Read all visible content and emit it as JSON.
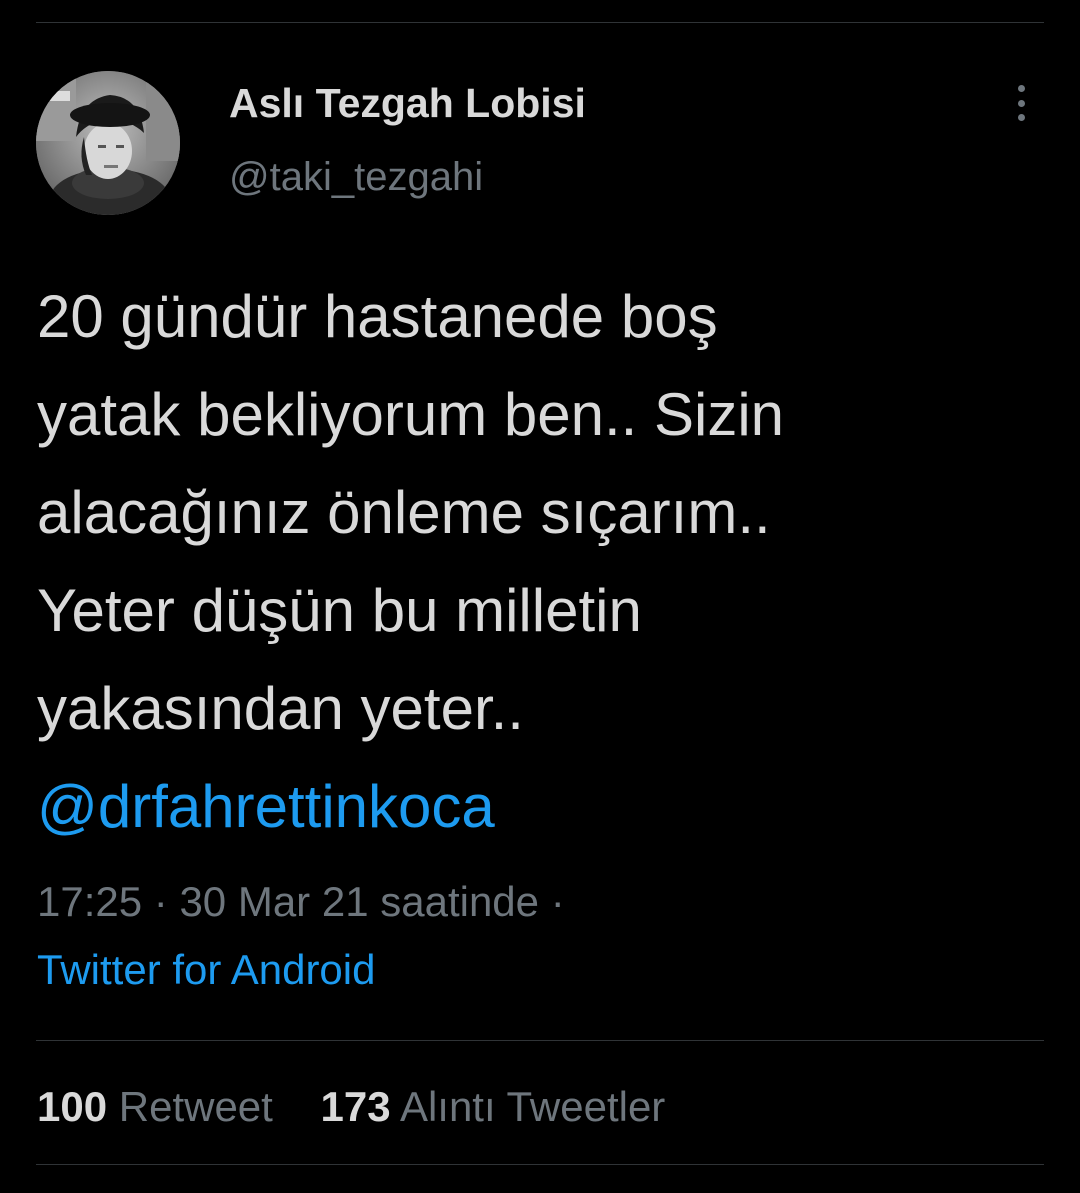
{
  "author": {
    "name": "Aslı Tezgah Lobisi",
    "handle": "@taki_tezgahi",
    "avatar_icon": "profile-photo"
  },
  "more_icon": "vertical-ellipsis-icon",
  "tweet": {
    "lines": [
      "20 gündür hastanede boş",
      "yatak bekliyorum ben.. Sizin",
      "alacağınız önleme sıçarım..",
      "Yeter düşün bu milletin",
      "yakasından yeter.."
    ],
    "mention": "@drfahrettinkoca"
  },
  "meta": {
    "time": "17:25",
    "separator": "·",
    "date": "30 Mar 21 saatinde",
    "trailing_separator": "·",
    "source": "Twitter for Android"
  },
  "stats": {
    "retweets_count": "100",
    "retweets_label": "Retweet",
    "quotes_count": "173",
    "quotes_label": "Alıntı Tweetler"
  },
  "colors": {
    "background": "#000000",
    "text": "#d9d9d9",
    "secondary": "#6e767d",
    "accent": "#1d9bf0",
    "divider": "#2f3336"
  }
}
